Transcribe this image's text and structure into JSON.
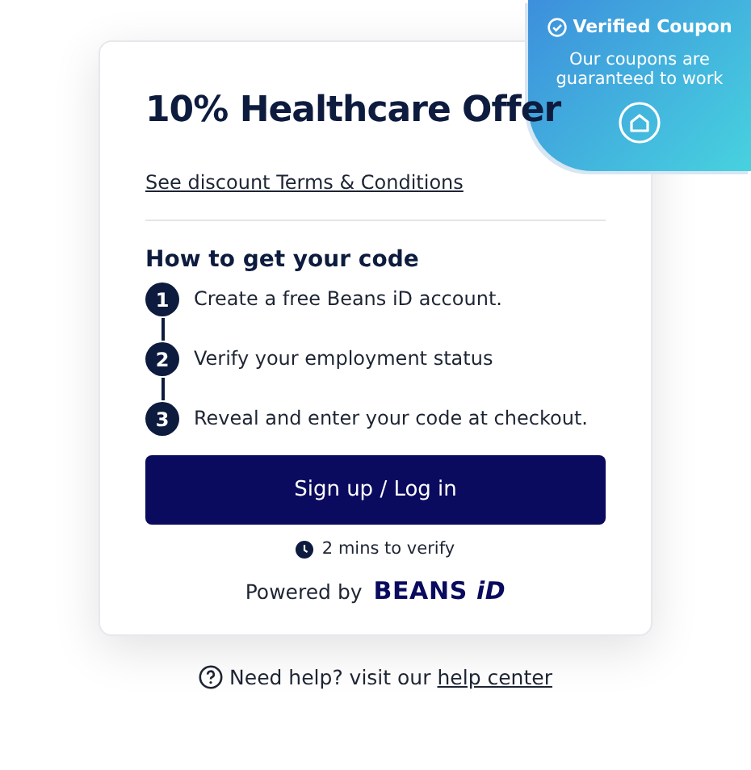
{
  "badge": {
    "title": "Verified Coupon",
    "text": "Our coupons are guaranteed to work"
  },
  "offer": {
    "title": "10% Healthcare Offer",
    "terms_link": "See discount Terms & Conditions"
  },
  "steps_heading": "How to get your code",
  "steps": [
    {
      "number": "1",
      "text": "Create a free Beans iD account."
    },
    {
      "number": "2",
      "text": "Verify your employment status"
    },
    {
      "number": "3",
      "text": "Reveal and enter your code at checkout."
    }
  ],
  "button": "Sign up / Log in",
  "verify_time": "2 mins to verify",
  "powered_by": {
    "label": "Powered by",
    "logo": "BEANS",
    "logo_mark": "iD"
  },
  "help": {
    "text": "Need help? visit our",
    "link": "help center"
  }
}
